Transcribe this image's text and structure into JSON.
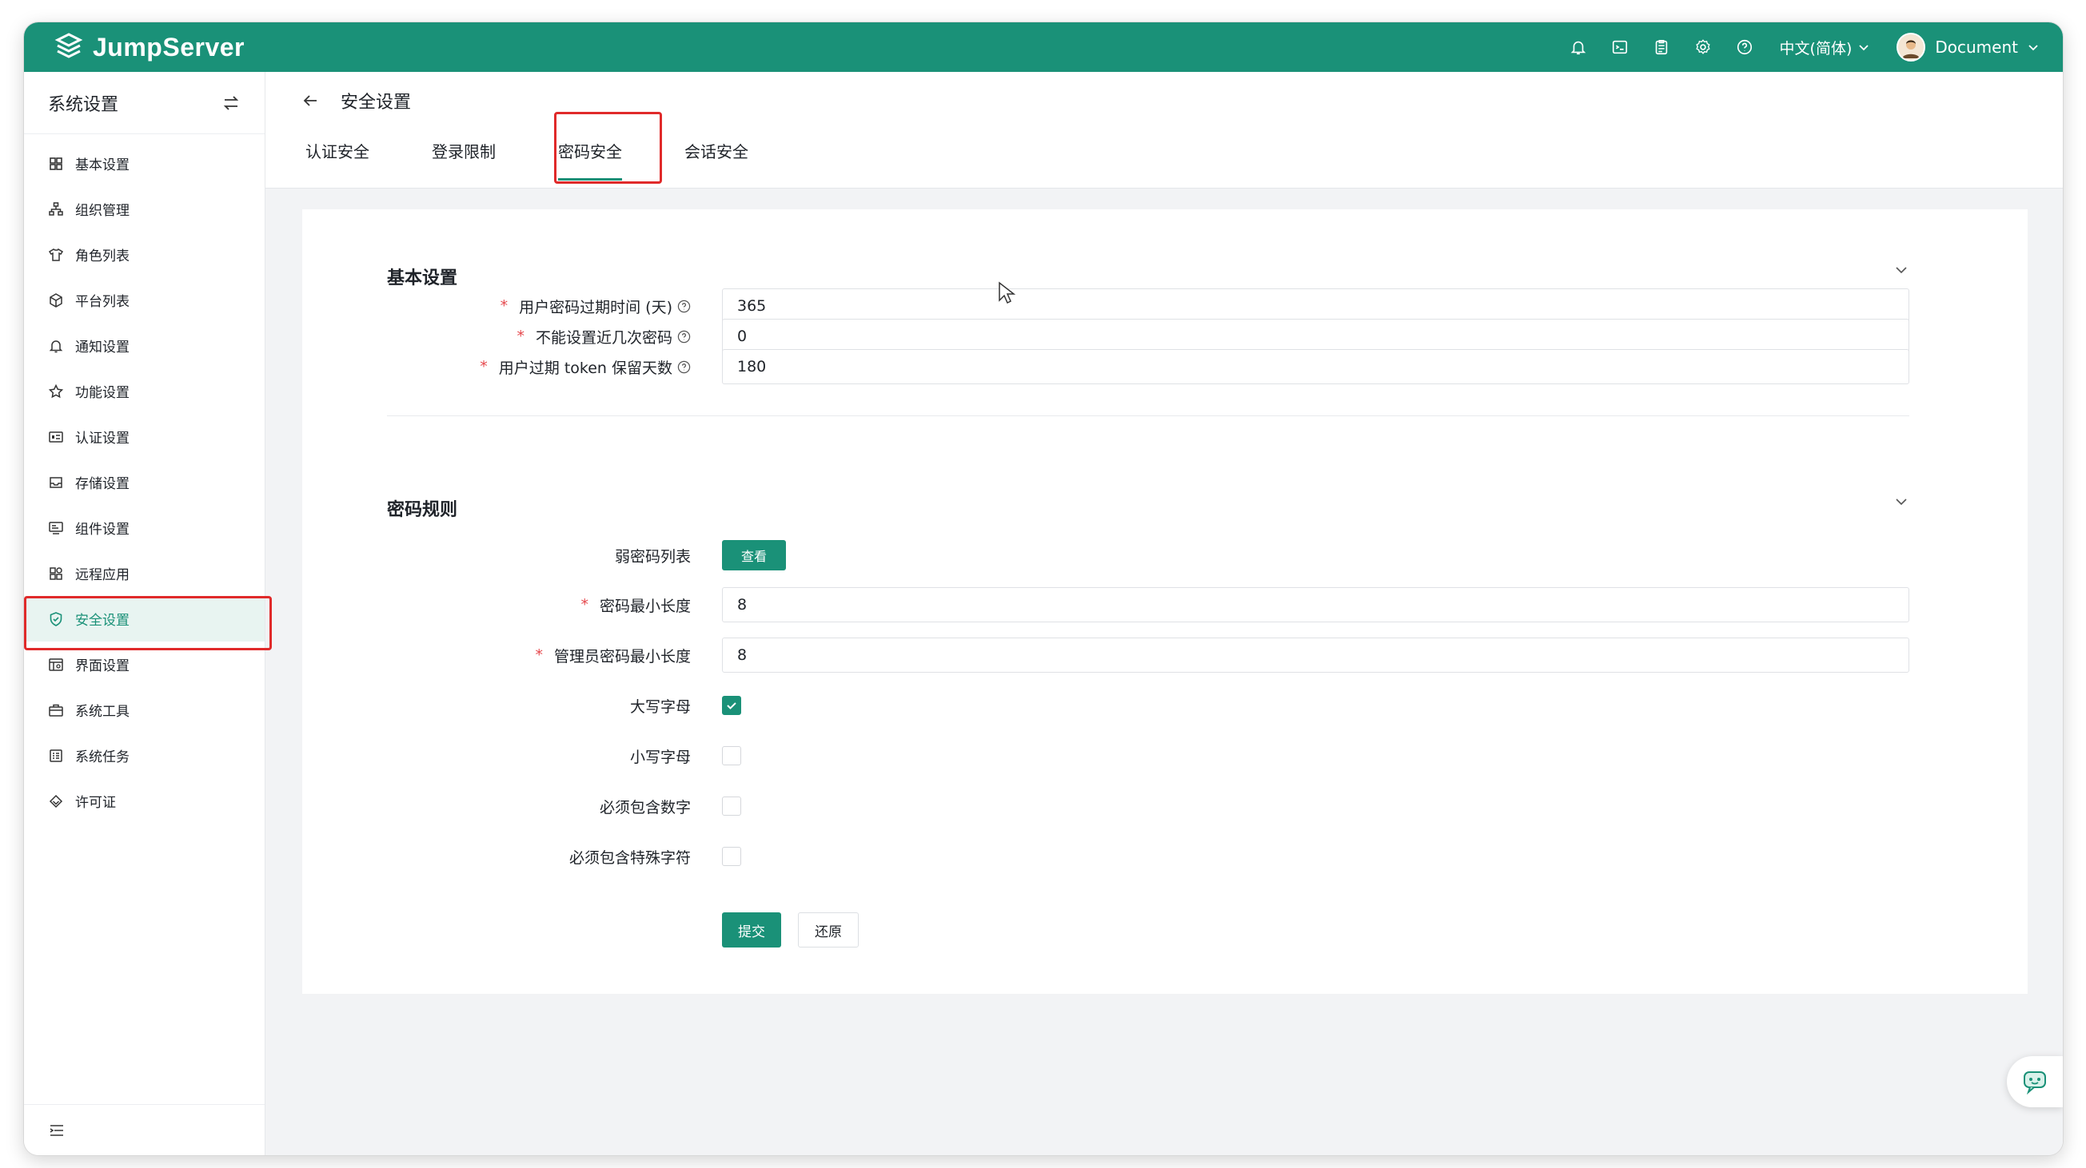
{
  "app": {
    "brand": "JumpServer"
  },
  "topbar": {
    "icons": [
      "bell-icon",
      "terminal-icon",
      "clipboard-icon",
      "gear-icon",
      "help-icon"
    ],
    "language": "中文(简体)",
    "user": "Document"
  },
  "sidebar": {
    "title": "系统设置",
    "items": [
      {
        "label": "基本设置",
        "icon": "grid-icon"
      },
      {
        "label": "组织管理",
        "icon": "org-icon"
      },
      {
        "label": "角色列表",
        "icon": "shirt-icon"
      },
      {
        "label": "平台列表",
        "icon": "cube-icon"
      },
      {
        "label": "通知设置",
        "icon": "bell-icon"
      },
      {
        "label": "功能设置",
        "icon": "star-icon"
      },
      {
        "label": "认证设置",
        "icon": "id-card-icon"
      },
      {
        "label": "存储设置",
        "icon": "inbox-icon"
      },
      {
        "label": "组件设置",
        "icon": "monitor-icon"
      },
      {
        "label": "远程应用",
        "icon": "apps-icon"
      },
      {
        "label": "安全设置",
        "icon": "shield-icon",
        "active": true
      },
      {
        "label": "界面设置",
        "icon": "layout-icon"
      },
      {
        "label": "系统工具",
        "icon": "toolbox-icon"
      },
      {
        "label": "系统任务",
        "icon": "task-icon"
      },
      {
        "label": "许可证",
        "icon": "diamond-icon"
      }
    ]
  },
  "page": {
    "title": "安全设置",
    "tabs": [
      {
        "label": "认证安全"
      },
      {
        "label": "登录限制"
      },
      {
        "label": "密码安全",
        "active": true
      },
      {
        "label": "会话安全"
      }
    ]
  },
  "basic": {
    "title": "基本设置",
    "fields": [
      {
        "label": "用户密码过期时间 (天)",
        "value": "365",
        "required": true,
        "help": true
      },
      {
        "label": "不能设置近几次密码",
        "value": "0",
        "required": true,
        "help": true
      },
      {
        "label": "用户过期 token 保留天数",
        "value": "180",
        "required": true,
        "help": true
      }
    ]
  },
  "rules": {
    "title": "密码规则",
    "weak_label": "弱密码列表",
    "view_button": "查看",
    "min_length_label": "密码最小长度",
    "min_length_value": "8",
    "admin_min_length_label": "管理员密码最小长度",
    "admin_min_length_value": "8",
    "checks": [
      {
        "label": "大写字母",
        "checked": true
      },
      {
        "label": "小写字母",
        "checked": false
      },
      {
        "label": "必须包含数字",
        "checked": false
      },
      {
        "label": "必须包含特殊字符",
        "checked": false
      }
    ]
  },
  "actions": {
    "submit": "提交",
    "reset": "还原"
  },
  "colors": {
    "brand": "#1a9178",
    "highlight": "#e02a2a",
    "required": "#e5484d"
  }
}
